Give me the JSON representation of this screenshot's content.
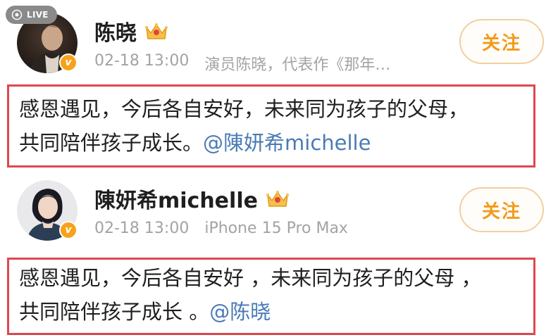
{
  "live_badge": {
    "label": "LIVE"
  },
  "posts": [
    {
      "username": "陈晓",
      "time": "02-18 13:00",
      "source": "演员陈晓，代表作《那年…",
      "follow_label": "关注",
      "content_lines": [
        "感恩遇见，今后各自安好，未来同为孩子的父母，",
        "共同陪伴孩子成长。"
      ],
      "mention": "@陳妍希michelle"
    },
    {
      "username": "陳妍希michelle",
      "time": "02-18 13:00",
      "source": "iPhone 15 Pro Max",
      "follow_label": "关注",
      "content_lines": [
        "感恩遇见，今后各自安好 ，未来同为孩子的父母 ，",
        "共同陪伴孩子成长 。"
      ],
      "mention": "@陈晓"
    }
  ],
  "colors": {
    "follow_text": "#f29a1a",
    "follow_border": "#f1cfa0",
    "mention": "#4a7bb5",
    "highlight_border": "#e0474f",
    "verified": "#f7a21b",
    "meta_text": "#a3a3a3"
  },
  "icons": {
    "live": "live-icon",
    "crown": "crown-icon",
    "verified": "verified-badge-icon"
  }
}
